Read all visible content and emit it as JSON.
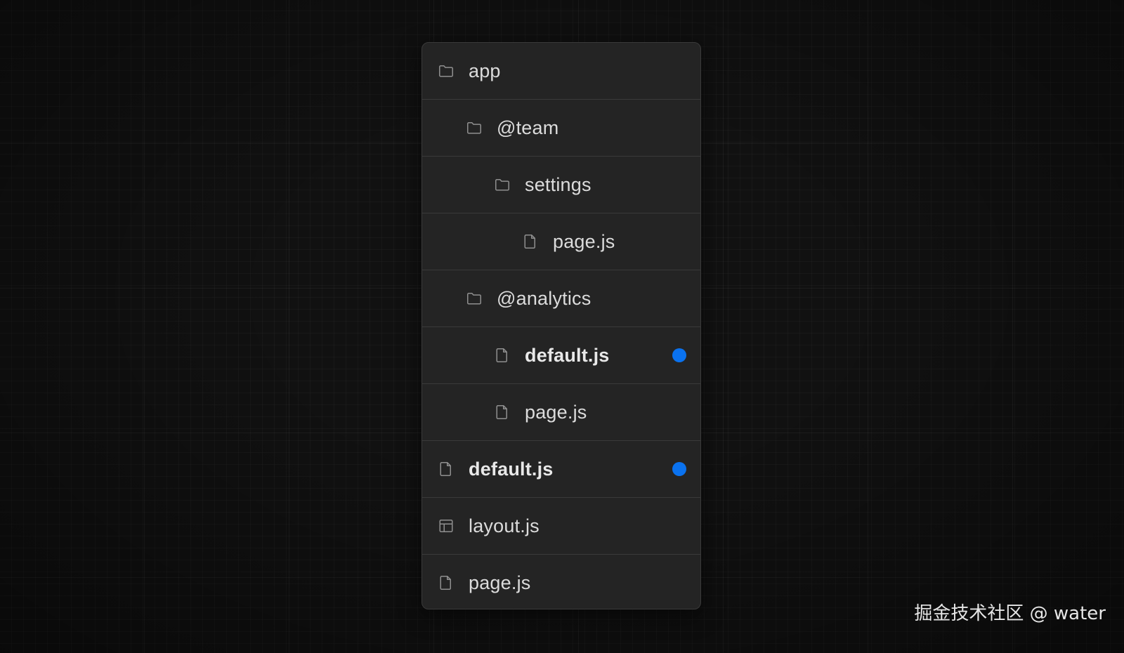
{
  "file_tree": {
    "rows": [
      {
        "label": "app",
        "icon": "folder-icon",
        "depth": 0,
        "bold": false,
        "marked": false
      },
      {
        "label": "@team",
        "icon": "folder-icon",
        "depth": 1,
        "bold": false,
        "marked": false
      },
      {
        "label": "settings",
        "icon": "folder-icon",
        "depth": 2,
        "bold": false,
        "marked": false
      },
      {
        "label": "page.js",
        "icon": "file-icon",
        "depth": 3,
        "bold": false,
        "marked": false
      },
      {
        "label": "@analytics",
        "icon": "folder-icon",
        "depth": 1,
        "bold": false,
        "marked": false
      },
      {
        "label": "default.js",
        "icon": "file-icon",
        "depth": 2,
        "bold": true,
        "marked": true
      },
      {
        "label": "page.js",
        "icon": "file-icon",
        "depth": 2,
        "bold": false,
        "marked": false
      },
      {
        "label": "default.js",
        "icon": "file-icon",
        "depth": 0,
        "bold": true,
        "marked": true
      },
      {
        "label": "layout.js",
        "icon": "layout-icon",
        "depth": 0,
        "bold": false,
        "marked": false
      },
      {
        "label": "page.js",
        "icon": "file-icon",
        "depth": 0,
        "bold": false,
        "marked": false
      }
    ]
  },
  "watermark": "掘金技术社区 @ water",
  "colors": {
    "background": "#111111",
    "panel": "#242424",
    "divider": "#3a3a3a",
    "text": "#dcdcdc",
    "icon": "#8f8f8f",
    "marker_dot": "#0a72ef"
  }
}
